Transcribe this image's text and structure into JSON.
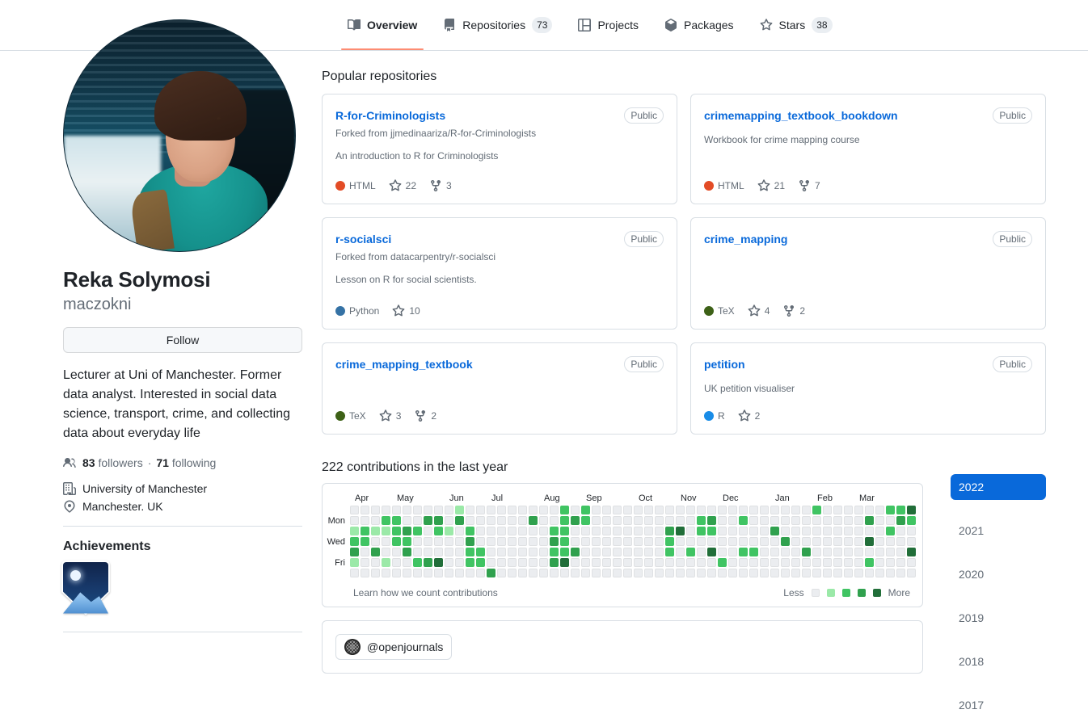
{
  "nav": {
    "tabs": [
      {
        "label": "Overview",
        "icon": "book-icon",
        "count": null,
        "active": true
      },
      {
        "label": "Repositories",
        "icon": "repo-icon",
        "count": "73",
        "active": false
      },
      {
        "label": "Projects",
        "icon": "project-icon",
        "count": null,
        "active": false
      },
      {
        "label": "Packages",
        "icon": "package-icon",
        "count": null,
        "active": false
      },
      {
        "label": "Stars",
        "icon": "star-icon",
        "count": "38",
        "active": false
      }
    ]
  },
  "profile": {
    "name": "Reka Solymosi",
    "login": "maczokni",
    "follow_label": "Follow",
    "bio": "Lecturer at Uni of Manchester. Former data analyst. Interested in social data science, transport, crime, and collecting data about everyday life",
    "followers_count": "83",
    "followers_label": "followers",
    "separator": "·",
    "following_count": "71",
    "following_label": "following",
    "organization": "University of Manchester",
    "location": "Manchester. UK",
    "achievements_title": "Achievements",
    "achievement_badge": "arctic-code-vault-badge"
  },
  "main": {
    "popular_title": "Popular repositories",
    "repos": [
      {
        "name": "R-for-Criminologists",
        "visibility": "Public",
        "forked_from": "Forked from jjmedinaariza/R-for-Criminologists",
        "description": "An introduction to R for Criminologists",
        "language": "HTML",
        "language_color": "#e34c26",
        "stars": "22",
        "forks": "3"
      },
      {
        "name": "crimemapping_textbook_bookdown",
        "visibility": "Public",
        "forked_from": null,
        "description": "Workbook for crime mapping course",
        "language": "HTML",
        "language_color": "#e34c26",
        "stars": "21",
        "forks": "7"
      },
      {
        "name": "r-socialsci",
        "visibility": "Public",
        "forked_from": "Forked from datacarpentry/r-socialsci",
        "description": "Lesson on R for social scientists.",
        "language": "Python",
        "language_color": "#3572A5",
        "stars": "10",
        "forks": null
      },
      {
        "name": "crime_mapping",
        "visibility": "Public",
        "forked_from": null,
        "description": null,
        "language": "TeX",
        "language_color": "#3D6117",
        "stars": "4",
        "forks": "2"
      },
      {
        "name": "crime_mapping_textbook",
        "visibility": "Public",
        "forked_from": null,
        "description": null,
        "language": "TeX",
        "language_color": "#3D6117",
        "stars": "3",
        "forks": "2"
      },
      {
        "name": "petition",
        "visibility": "Public",
        "forked_from": null,
        "description": "UK petition visualiser",
        "language": "R",
        "language_color": "#198CE7",
        "stars": "2",
        "forks": null
      }
    ]
  },
  "contributions": {
    "title": "222 contributions in the last year",
    "learn_link": "Learn how we count contributions",
    "less_label": "Less",
    "more_label": "More",
    "months": [
      "Apr",
      "May",
      "Jun",
      "Jul",
      "Aug",
      "Sep",
      "Oct",
      "Nov",
      "Dec",
      "Jan",
      "Feb",
      "Mar"
    ],
    "days": [
      "Mon",
      "Wed",
      "Fri"
    ],
    "level_colors": [
      "#ebedf0",
      "#9be9a8",
      "#40c463",
      "#30a14e",
      "#216e39"
    ],
    "total": 222,
    "weeks": [
      [
        0,
        0,
        1,
        2,
        3,
        1,
        0
      ],
      [
        0,
        0,
        2,
        2,
        0,
        0,
        0
      ],
      [
        0,
        0,
        1,
        0,
        3,
        0,
        0
      ],
      [
        0,
        2,
        1,
        0,
        0,
        1,
        0
      ],
      [
        0,
        2,
        2,
        2,
        0,
        0,
        0
      ],
      [
        0,
        0,
        3,
        2,
        3,
        0,
        0
      ],
      [
        0,
        0,
        2,
        0,
        0,
        2,
        0
      ],
      [
        0,
        3,
        0,
        0,
        0,
        3,
        0
      ],
      [
        0,
        3,
        2,
        0,
        0,
        4,
        0
      ],
      [
        0,
        0,
        1,
        0,
        0,
        0,
        0
      ],
      [
        1,
        3,
        0,
        0,
        0,
        0,
        0
      ],
      [
        0,
        0,
        2,
        3,
        2,
        2,
        0
      ],
      [
        0,
        0,
        0,
        0,
        2,
        2,
        0
      ],
      [
        0,
        0,
        0,
        0,
        0,
        0,
        3
      ],
      [
        0,
        0,
        0,
        0,
        0,
        0,
        0
      ],
      [
        0,
        0,
        0,
        0,
        0,
        0,
        0
      ],
      [
        0,
        0,
        0,
        0,
        0,
        0,
        0
      ],
      [
        0,
        3,
        0,
        0,
        0,
        0,
        0
      ],
      [
        0,
        0,
        0,
        0,
        0,
        0,
        0
      ],
      [
        0,
        0,
        2,
        3,
        2,
        3,
        0
      ],
      [
        2,
        2,
        2,
        2,
        2,
        4,
        0
      ],
      [
        0,
        3,
        0,
        0,
        3,
        0,
        0
      ],
      [
        2,
        2,
        0,
        0,
        0,
        0,
        0
      ],
      [
        0,
        0,
        0,
        0,
        0,
        0,
        0
      ],
      [
        0,
        0,
        0,
        0,
        0,
        0,
        0
      ],
      [
        0,
        0,
        0,
        0,
        0,
        0,
        0
      ],
      [
        0,
        0,
        0,
        0,
        0,
        0,
        0
      ],
      [
        0,
        0,
        0,
        0,
        0,
        0,
        0
      ],
      [
        0,
        0,
        0,
        0,
        0,
        0,
        0
      ],
      [
        0,
        0,
        0,
        0,
        0,
        0,
        0
      ],
      [
        0,
        0,
        3,
        2,
        2,
        0,
        0
      ],
      [
        0,
        0,
        4,
        0,
        0,
        0,
        0
      ],
      [
        0,
        0,
        0,
        0,
        2,
        0,
        0
      ],
      [
        0,
        2,
        2,
        0,
        0,
        0,
        0
      ],
      [
        0,
        3,
        2,
        0,
        4,
        0,
        0
      ],
      [
        0,
        0,
        0,
        0,
        0,
        2,
        0
      ],
      [
        0,
        0,
        0,
        0,
        0,
        0,
        0
      ],
      [
        0,
        2,
        0,
        0,
        2,
        0,
        0
      ],
      [
        0,
        0,
        0,
        0,
        2,
        0,
        0
      ],
      [
        0,
        0,
        0,
        0,
        0,
        0,
        0
      ],
      [
        0,
        0,
        3,
        0,
        0,
        0,
        0
      ],
      [
        0,
        0,
        0,
        3,
        0,
        0,
        0
      ],
      [
        0,
        0,
        0,
        0,
        0,
        0,
        0
      ],
      [
        0,
        0,
        0,
        0,
        3,
        0,
        0
      ],
      [
        2,
        0,
        0,
        0,
        0,
        0,
        0
      ],
      [
        0,
        0,
        0,
        0,
        0,
        0,
        0
      ],
      [
        0,
        0,
        0,
        0,
        0,
        0,
        0
      ],
      [
        0,
        0,
        0,
        0,
        0,
        0,
        0
      ],
      [
        0,
        0,
        0,
        0,
        0,
        0,
        0
      ],
      [
        0,
        3,
        0,
        4,
        0,
        2,
        0
      ],
      [
        0,
        0,
        0,
        0,
        0,
        0,
        0
      ],
      [
        2,
        0,
        2,
        0,
        0,
        0,
        0
      ],
      [
        2,
        3,
        0,
        0,
        0,
        0,
        0
      ],
      [
        4,
        2,
        0,
        0,
        4,
        0,
        0
      ]
    ]
  },
  "years": [
    {
      "label": "2022",
      "active": true
    },
    {
      "label": "2021",
      "active": false
    },
    {
      "label": "2020",
      "active": false
    },
    {
      "label": "2019",
      "active": false
    },
    {
      "label": "2018",
      "active": false
    },
    {
      "label": "2017",
      "active": false
    }
  ],
  "activity": {
    "org_handle": "@openjournals"
  }
}
